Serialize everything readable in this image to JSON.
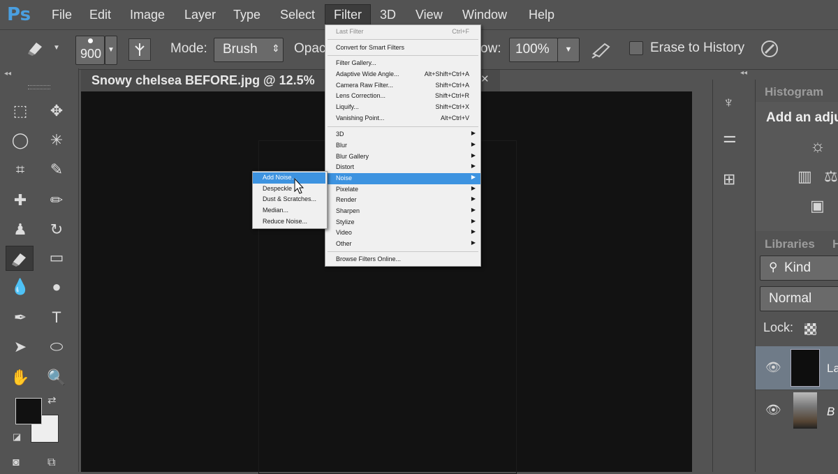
{
  "app": {
    "logo": "Ps"
  },
  "menubar": [
    "File",
    "Edit",
    "Image",
    "Layer",
    "Type",
    "Select",
    "Filter",
    "3D",
    "View",
    "Window",
    "Help"
  ],
  "options": {
    "brush_size": "900",
    "mode_label": "Mode:",
    "mode_value": "Brush",
    "opacity_label": "Opac",
    "flow_label": "ow:",
    "flow_value": "100%",
    "erase_history_label": "Erase to History"
  },
  "document": {
    "title": "Snowy chelsea BEFORE.jpg @ 12.5%"
  },
  "filter_menu": {
    "last_filter": {
      "label": "Last Filter",
      "shortcut": "Ctrl+F"
    },
    "smart": {
      "label": "Convert for Smart Filters"
    },
    "gallery": [
      {
        "label": "Filter Gallery...",
        "shortcut": ""
      },
      {
        "label": "Adaptive Wide Angle...",
        "shortcut": "Alt+Shift+Ctrl+A"
      },
      {
        "label": "Camera Raw Filter...",
        "shortcut": "Shift+Ctrl+A"
      },
      {
        "label": "Lens Correction...",
        "shortcut": "Shift+Ctrl+R"
      },
      {
        "label": "Liquify...",
        "shortcut": "Shift+Ctrl+X"
      },
      {
        "label": "Vanishing Point...",
        "shortcut": "Alt+Ctrl+V"
      }
    ],
    "submenus": [
      "3D",
      "Blur",
      "Blur Gallery",
      "Distort",
      "Noise",
      "Pixelate",
      "Render",
      "Sharpen",
      "Stylize",
      "Video",
      "Other"
    ],
    "browse": "Browse Filters Online..."
  },
  "noise_menu": [
    "Add Noise...",
    "Despeckle",
    "Dust & Scratches...",
    "Median...",
    "Reduce Noise..."
  ],
  "right_panel": {
    "histogram_tab": "Histogram",
    "adjust_text": "Add an adju",
    "libraries_tab": "Libraries",
    "second_tab": "H",
    "kind_label": "Kind",
    "blend_mode": "Normal",
    "lock_label": "Lock:",
    "layer1_label": "La",
    "layer2_label": "B"
  }
}
